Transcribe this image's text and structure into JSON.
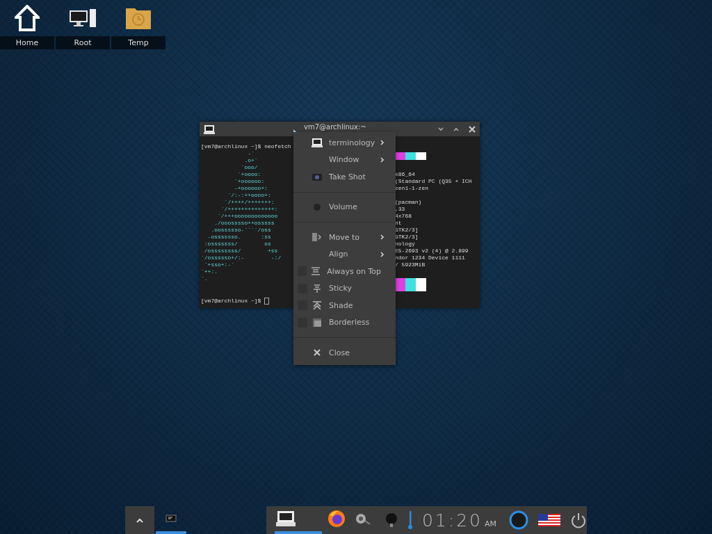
{
  "desktop_icons": [
    {
      "label": "Home"
    },
    {
      "label": "Root"
    },
    {
      "label": "Temp"
    }
  ],
  "terminal": {
    "title": "vm7@archlinux:~",
    "left_lines": [
      "[vm7@archlinux ~]$ neofetch",
      "              -`",
      "             .o+`",
      "            `ooo/",
      "           `+oooo:",
      "          `+oooooo:",
      "          -+oooooo+:",
      "        `/:-:++oooo+:",
      "       `/++++/+++++++:",
      "      `/++++++++++++++:",
      "     `/+++ooooooooooooo",
      "    ./ooosssso++osssss",
      "   .oossssso-````/oss",
      "  -osssssso.      :ss",
      " :osssssss/        os",
      " /ossssssss/        +ss",
      "`/ossssso+/:-        -:/",
      " `+sso+:-`",
      "`++:.",
      "`."
    ],
    "right_groups": [
      [
        "x86_64",
        "(Standard PC (Q35 + ICH",
        "zen1-1-zen"
      ],
      [
        "(pacman)",
        ",33",
        "4x768",
        "nt",
        "GTK2/3]",
        "GTK2/3]",
        "nology",
        "E5-2693 v2 (4) @ 2.899",
        "ndor 1234 Device 1111",
        "/ 5923MiB"
      ]
    ],
    "prompt": "[vm7@archlinux ~]$ "
  },
  "context_menu": {
    "items": [
      {
        "kind": "item",
        "label": "terminology",
        "submenu": true
      },
      {
        "kind": "item",
        "label": "Window",
        "submenu": true
      },
      {
        "kind": "item",
        "label": "Take Shot",
        "submenu": false
      },
      {
        "kind": "separator"
      },
      {
        "kind": "item",
        "label": "Volume",
        "submenu": false
      },
      {
        "kind": "separator"
      },
      {
        "kind": "item",
        "label": "Move to",
        "submenu": true
      },
      {
        "kind": "item",
        "label": "Align",
        "submenu": true
      },
      {
        "kind": "check",
        "label": "Always on Top",
        "checked": false
      },
      {
        "kind": "check",
        "label": "Sticky",
        "checked": false
      },
      {
        "kind": "check",
        "label": "Shade",
        "checked": false
      },
      {
        "kind": "check",
        "label": "Borderless",
        "checked": false
      },
      {
        "kind": "separator"
      },
      {
        "kind": "item",
        "label": "Close",
        "submenu": false
      }
    ]
  },
  "taskbar": {
    "tasks": [
      {
        "selected": true
      }
    ],
    "pinned": [
      {
        "selected": true
      },
      {
        "selected": false
      },
      {
        "selected": false
      }
    ],
    "clock": {
      "time": "01:20",
      "ampm": "AM"
    }
  }
}
